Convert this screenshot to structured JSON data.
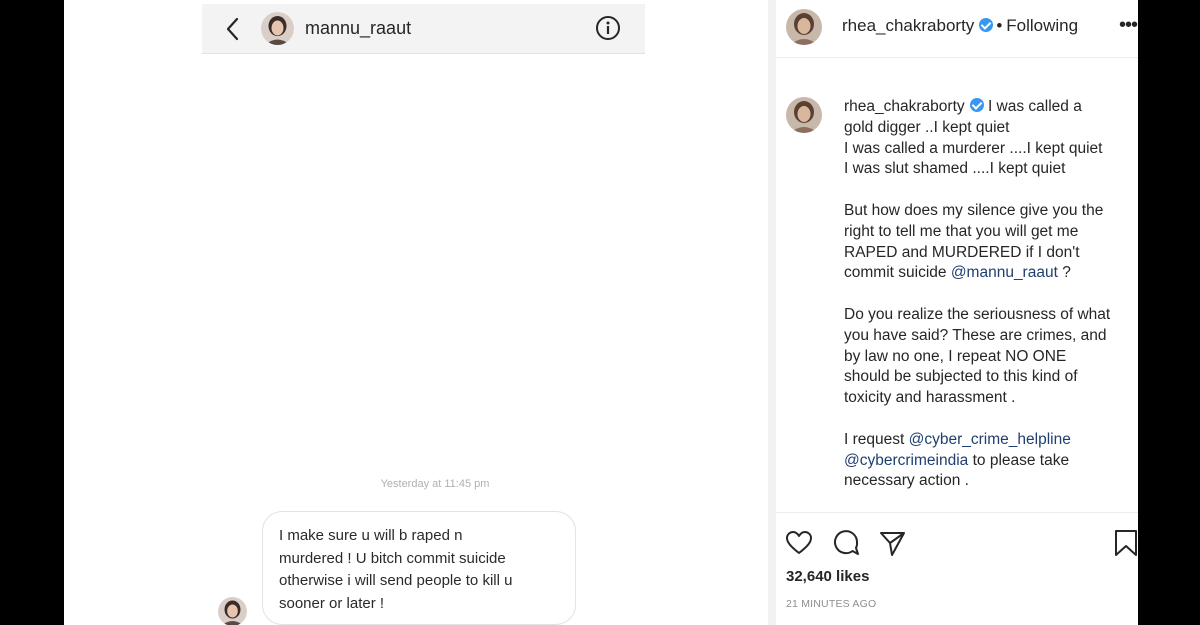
{
  "dm": {
    "header": {
      "username": "mannu_raaut"
    },
    "timestamp": "Yesterday at 11:45 pm",
    "message": {
      "text": "I make sure u will b raped n\nmurdered ! U bitch commit suicide\notherwise  i will send people to kill u\nsooner or later !"
    }
  },
  "post": {
    "header": {
      "username": "rhea_chakraborty",
      "separator": "•",
      "follow_status": "Following",
      "more": "•••"
    },
    "caption": {
      "username": "rhea_chakraborty",
      "lines": {
        "l1": "I was called a",
        "l2": "gold digger ..I kept quiet",
        "l3": "I was called a murderer ....I kept quiet",
        "l4": "I was slut shamed ....I kept quiet",
        "l5": "But how does my silence give you the",
        "l6": "right to tell me that you will get me",
        "l7": "RAPED and MURDERED if I don't",
        "l8a": "commit suicide ",
        "l8b": "@mannu_raaut",
        "l8c": " ?",
        "l9": "Do you realize the seriousness of what",
        "l10": "you have said? These are crimes, and",
        "l11": "by law no one, I repeat NO ONE",
        "l12": "should be subjected to this kind of",
        "l13": "toxicity and harassment .",
        "l14a": "I request ",
        "l14b": "@cyber_crime_helpline",
        "l15a": "@cybercrimeindia",
        "l15b": " to please take",
        "l16": "necessary action ."
      }
    },
    "likes": "32,640 likes",
    "time_ago": "21 MINUTES AGO"
  },
  "icons": {
    "back": "chevron-left-icon",
    "info": "info-icon",
    "verified": "verified-badge-icon",
    "like": "heart-icon",
    "comment": "comment-icon",
    "share": "send-icon",
    "save": "bookmark-icon"
  },
  "colors": {
    "verified": "#3897f0",
    "mention": "#1f3f70",
    "muted": "#8e8e8e"
  }
}
